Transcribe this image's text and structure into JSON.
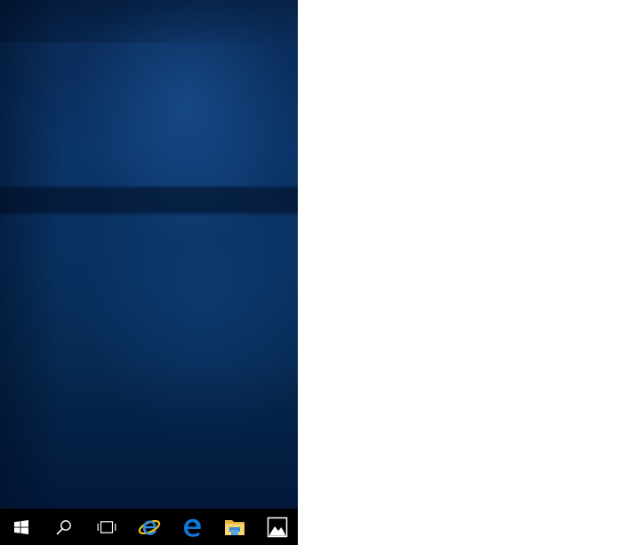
{
  "desktop": {
    "wallpaper": "windows-10-hero-blue",
    "colors": {
      "wallpaper_base": "#0b3468",
      "taskbar": "#000000",
      "background": "#ffffff"
    }
  },
  "taskbar": {
    "items": [
      {
        "icon": "windows-start-icon"
      },
      {
        "icon": "search-icon"
      },
      {
        "icon": "task-view-icon"
      },
      {
        "icon": "internet-explorer-icon"
      },
      {
        "icon": "edge-icon"
      },
      {
        "icon": "file-explorer-icon"
      },
      {
        "icon": "photos-icon"
      }
    ]
  }
}
